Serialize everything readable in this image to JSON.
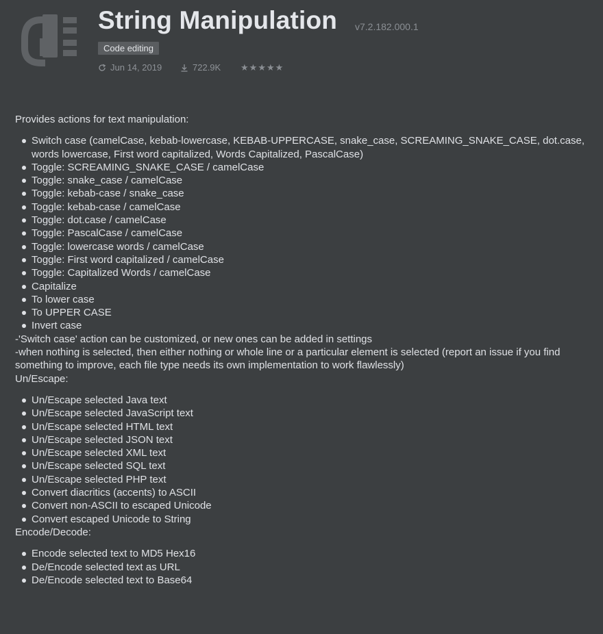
{
  "header": {
    "title": "String Manipulation",
    "version": "v7.2.182.000.1",
    "tag": "Code editing",
    "date": "Jun 14, 2019",
    "downloads": "722.9K",
    "rating_stars": 5,
    "icons": [
      "plugin-logo-icon",
      "refresh-icon",
      "download-icon",
      "star-icon"
    ]
  },
  "intro": "Provides actions for text manipulation:",
  "case_items": [
    "Switch case (camelCase, kebab-lowercase, KEBAB-UPPERCASE, snake_case, SCREAMING_SNAKE_CASE, dot.case, words lowercase, First word capitalized, Words Capitalized, PascalCase)",
    "Toggle: SCREAMING_SNAKE_CASE / camelCase",
    "Toggle: snake_case / camelCase",
    "Toggle: kebab-case / snake_case",
    "Toggle: kebab-case / camelCase",
    "Toggle: dot.case / camelCase",
    "Toggle: PascalCase / camelCase",
    "Toggle: lowercase words / camelCase",
    "Toggle: First word capitalized / camelCase",
    "Toggle: Capitalized Words / camelCase",
    "Capitalize",
    "To lower case",
    "To UPPER CASE",
    "Invert case"
  ],
  "notes": [
    "-'Switch case' action can be customized, or new ones can be added in settings",
    "-when nothing is selected, then either nothing or whole line or a particular element is selected (report an issue if you find something to improve, each file type needs its own implementation to work flawlessly)"
  ],
  "escape_heading": "Un/Escape:",
  "escape_items": [
    "Un/Escape selected Java text",
    "Un/Escape selected JavaScript text",
    "Un/Escape selected HTML text",
    "Un/Escape selected JSON text",
    "Un/Escape selected XML text",
    "Un/Escape selected SQL text",
    "Un/Escape selected PHP text",
    "Convert diacritics (accents) to ASCII",
    "Convert non-ASCII to escaped Unicode",
    "Convert escaped Unicode to String"
  ],
  "encode_heading": "Encode/Decode:",
  "encode_items": [
    "Encode selected text to MD5 Hex16",
    "De/Encode selected text as URL",
    "De/Encode selected text to Base64"
  ],
  "colors": {
    "background": "#3c3f41",
    "text": "#dfe1e5",
    "muted": "#8e9297",
    "tag_bg": "#5a5d60"
  }
}
